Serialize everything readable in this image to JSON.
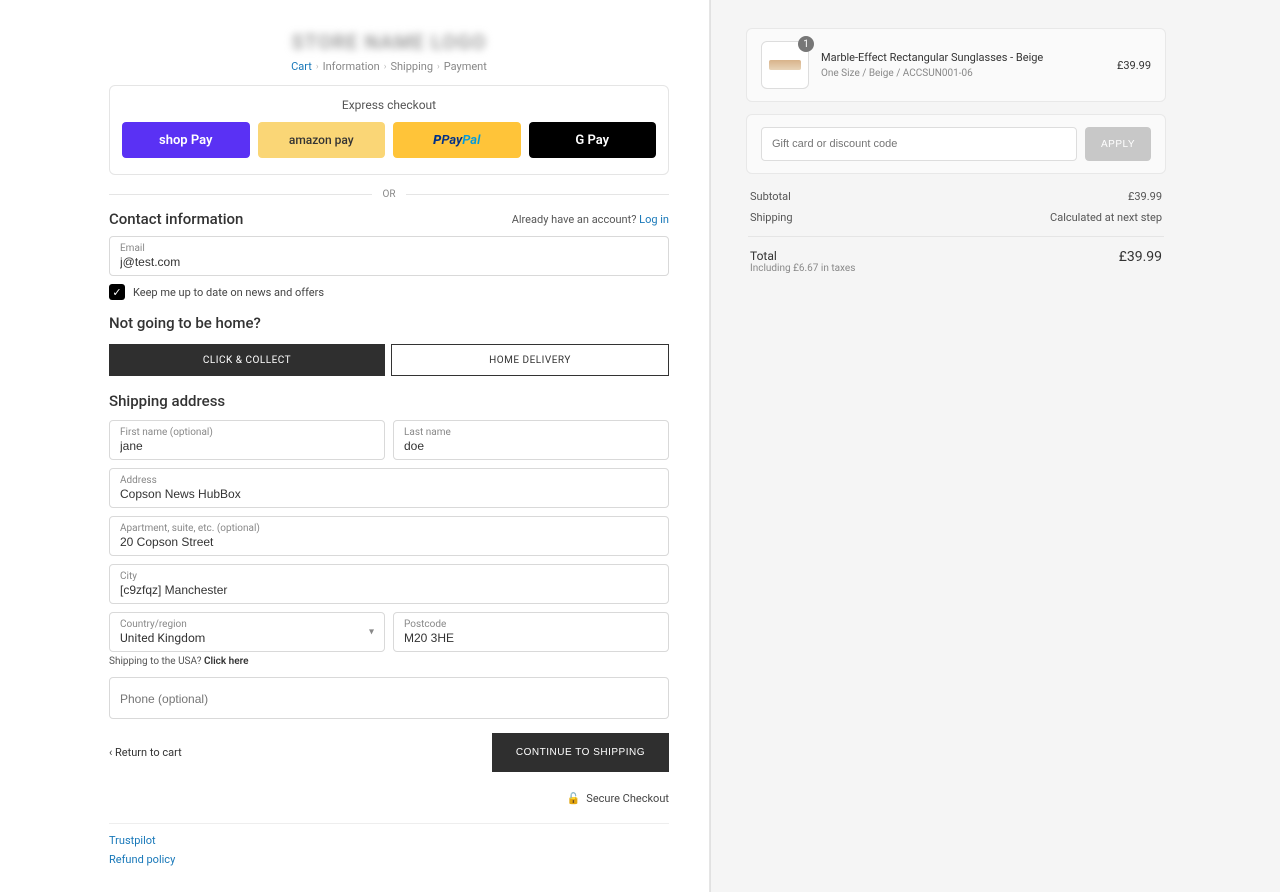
{
  "header": {
    "logo_text": "STORE NAME LOGO"
  },
  "breadcrumbs": {
    "cart": "Cart",
    "information": "Information",
    "shipping": "Shipping",
    "payment": "Payment"
  },
  "express": {
    "title": "Express checkout",
    "shoppay": "shop Pay",
    "amazon": "amazon pay",
    "paypal_p": "P ",
    "paypal_pay": "Pay",
    "paypal_pal": "Pal",
    "gpay": "G Pay",
    "or": "OR"
  },
  "contact": {
    "heading": "Contact information",
    "have_account": "Already have an account? ",
    "login": "Log in",
    "email_label": "Email",
    "email_value": "j@test.com",
    "news_optin": "Keep me up to date on news and offers"
  },
  "delivery": {
    "heading": "Not going to be home?",
    "click_collect": "CLICK & COLLECT",
    "home_delivery": "HOME DELIVERY"
  },
  "shipping": {
    "heading": "Shipping address",
    "first_label": "First name (optional)",
    "first_value": "jane",
    "last_label": "Last name",
    "last_value": "doe",
    "address_label": "Address",
    "address_value": "Copson News HubBox",
    "apt_label": "Apartment, suite, etc. (optional)",
    "apt_value": "20 Copson Street",
    "city_label": "City",
    "city_value": "[c9zfqz] Manchester",
    "country_label": "Country/region",
    "country_value": "United Kingdom",
    "postcode_label": "Postcode",
    "postcode_value": "M20 3HE",
    "usa_hint_a": "Shipping to the USA? ",
    "usa_hint_b": "Click here",
    "phone_placeholder": "Phone (optional)"
  },
  "nav": {
    "return": "‹ Return to cart",
    "continue": "CONTINUE TO SHIPPING",
    "secure": "Secure Checkout"
  },
  "footer": {
    "trustpilot": "Trustpilot",
    "refund": "Refund policy"
  },
  "order": {
    "product_title": "Marble-Effect Rectangular Sunglasses - Beige",
    "product_variant": "One Size / Beige / ACCSUN001-06",
    "product_price": "£39.99",
    "product_qty": "1",
    "discount_placeholder": "Gift card or discount code",
    "apply": "APPLY",
    "subtotal_label": "Subtotal",
    "subtotal_value": "£39.99",
    "shipping_label": "Shipping",
    "shipping_value": "Calculated at next step",
    "total_label": "Total",
    "total_tax": "Including £6.67 in taxes",
    "total_value": "£39.99"
  }
}
